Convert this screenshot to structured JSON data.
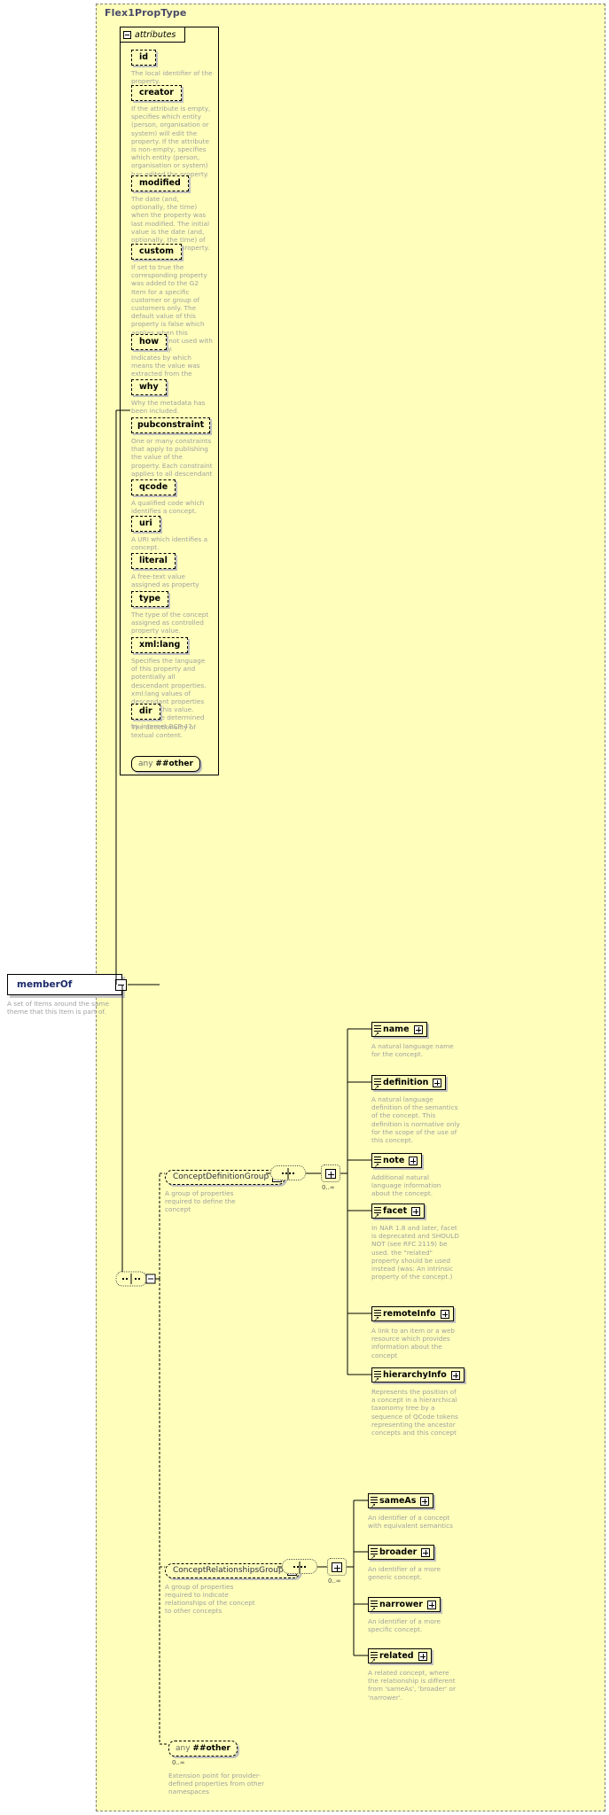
{
  "type_panel": {
    "title": "Flex1PropType"
  },
  "attributes_section": {
    "label": "attributes",
    "items": [
      {
        "name": "id",
        "desc": "The local identifier of the property."
      },
      {
        "name": "creator",
        "desc": "If the attribute is empty, specifies which entity (person, organisation or system) will edit the property. If the attribute is non-empty, specifies which entity (person, organisation or system) has edited the property."
      },
      {
        "name": "modified",
        "desc": "The date (and, optionally, the time) when the property was last modified. The initial value is the date (and, optionally, the time) of creation of the property."
      },
      {
        "name": "custom",
        "desc": "If set to true the corresponding property was added to the G2 Item for a specific customer or group of customers only. The default value of this property is false which applies when this attribute is not used with the property."
      },
      {
        "name": "how",
        "desc": "Indicates by which means the value was extracted from the content."
      },
      {
        "name": "why",
        "desc": "Why the metadata has been included."
      },
      {
        "name": "pubconstraint",
        "desc": "One or many constraints that apply to publishing the value of the property. Each constraint applies to all descendant elements."
      },
      {
        "name": "qcode",
        "desc": "A qualified code which identifies a concept."
      },
      {
        "name": "uri",
        "desc": "A URI which identifies a concept."
      },
      {
        "name": "literal",
        "desc": "A free-text value assigned as property value."
      },
      {
        "name": "type",
        "desc": "The type of the concept assigned as controlled property value."
      },
      {
        "name": "xml:lang",
        "desc": "Specifies the language of this property and potentially all descendant properties. xml:lang values of descendant properties override this value. Values are determined by Internet BCP 47."
      },
      {
        "name": "dir",
        "desc": "The directionality of textual content."
      }
    ],
    "any_node": {
      "any": "any",
      "other": "##other"
    }
  },
  "root_element": {
    "name": "memberOf",
    "desc": "A set of Items around the same theme that this Item is part of."
  },
  "concept_definition_group": {
    "label": "ConceptDefinitionGroup",
    "desc": "A group of properties required to define the concept",
    "occurs": "0..∞",
    "elements": [
      {
        "name": "name",
        "desc": "A natural language name for the concept."
      },
      {
        "name": "definition",
        "desc": "A natural language definition of the semantics of the concept. This definition is normative only for the scope of the use of this concept."
      },
      {
        "name": "note",
        "desc": "Additional natural language information about the concept."
      },
      {
        "name": "facet",
        "desc": "In NAR 1.8 and later, facet is deprecated and SHOULD NOT (see RFC 2119) be used. the \"related\" property should be used instead (was: An intrinsic property of the concept.)"
      },
      {
        "name": "remoteInfo",
        "desc": "A link to an item or a web resource which provides information about the concept"
      },
      {
        "name": "hierarchyInfo",
        "desc": "Represents the position of a concept in a hierarchical taxonomy tree by a sequence of QCode tokens representing the ancestor concepts and this concept"
      }
    ]
  },
  "concept_relationships_group": {
    "label": "ConceptRelationshipsGroup",
    "desc": "A group of properties required to indicate relationships of the concept to other concepts",
    "occurs": "0..∞",
    "elements": [
      {
        "name": "sameAs",
        "desc": "An identifier of a concept with equivalent semantics"
      },
      {
        "name": "broader",
        "desc": "An identifier of a more generic concept."
      },
      {
        "name": "narrower",
        "desc": "An identifier of a more specific concept."
      },
      {
        "name": "related",
        "desc": "A related concept, where the relationship is different from 'sameAs', 'broader' or 'narrower'."
      }
    ]
  },
  "any_other_block": {
    "any": "any",
    "other": "##other",
    "occurs": "0..∞",
    "desc": "Extension point for provider-defined properties from other namespaces"
  },
  "colors": {
    "panel_bg": "#ffffbb",
    "desc_text": "#a0a0a0",
    "element_label": "#000000",
    "root_label": "#1b2a6b",
    "type_title": "#4a4a6a"
  }
}
